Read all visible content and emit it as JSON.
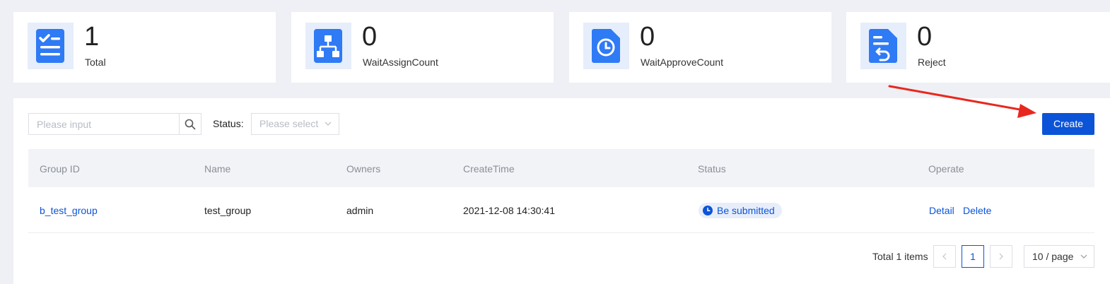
{
  "stats": [
    {
      "count": "1",
      "label": "Total",
      "icon": "checklist-icon"
    },
    {
      "count": "0",
      "label": "WaitAssignCount",
      "icon": "hierarchy-icon"
    },
    {
      "count": "0",
      "label": "WaitApproveCount",
      "icon": "clock-document-icon"
    },
    {
      "count": "0",
      "label": "Reject",
      "icon": "return-document-icon"
    }
  ],
  "toolbar": {
    "search_placeholder": "Please input",
    "status_label": "Status",
    "status_placeholder": "Please select",
    "create_label": "Create"
  },
  "table": {
    "columns": [
      "Group ID",
      "Name",
      "Owners",
      "CreateTime",
      "Status",
      "Operate"
    ],
    "rows": [
      {
        "group_id": "b_test_group",
        "name": "test_group",
        "owners": "admin",
        "create_time": "2021-12-08 14:30:41",
        "status": "Be submitted",
        "actions": [
          "Detail",
          "Delete"
        ]
      }
    ]
  },
  "pagination": {
    "total_text": "Total 1 items",
    "current_page": "1",
    "page_size": "10 / page"
  },
  "colors": {
    "primary": "#0b54d8",
    "icon_blue": "#2f7af5",
    "annotation_arrow": "#e8281e"
  }
}
